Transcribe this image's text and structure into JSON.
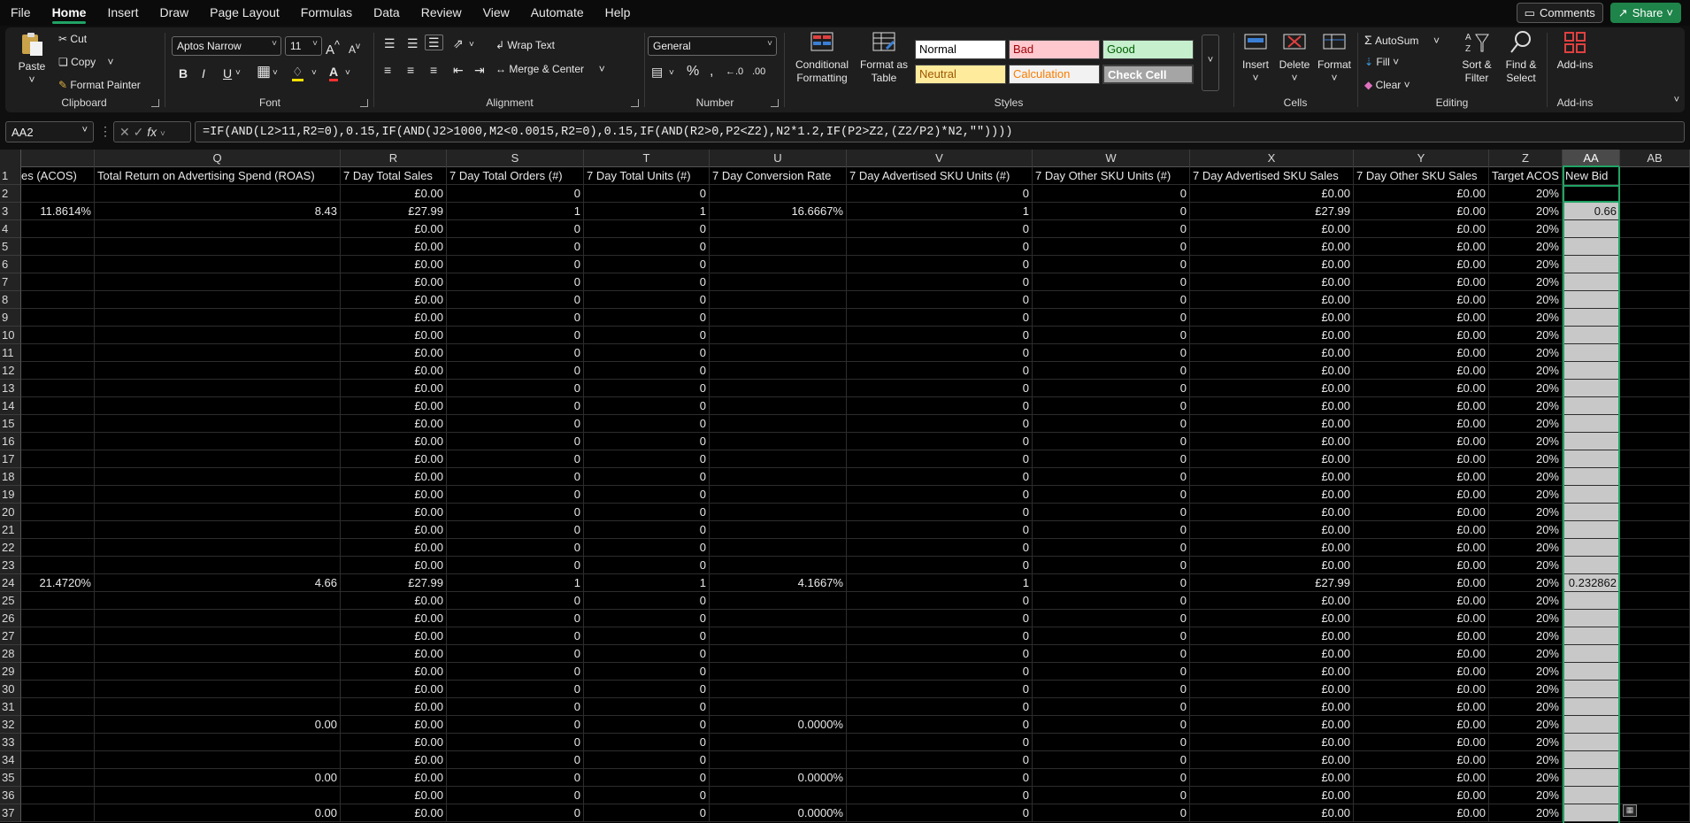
{
  "menu": [
    "File",
    "Home",
    "Insert",
    "Draw",
    "Page Layout",
    "Formulas",
    "Data",
    "Review",
    "View",
    "Automate",
    "Help"
  ],
  "topbar": {
    "comments": "Comments",
    "share": "Share"
  },
  "ribbon": {
    "clipboard": {
      "label": "Clipboard",
      "paste": "Paste",
      "cut": "Cut",
      "copy": "Copy",
      "format_painter": "Format Painter"
    },
    "font": {
      "label": "Font",
      "name": "Aptos Narrow",
      "size": "11",
      "grow": "A",
      "shrink": "A",
      "bold": "B",
      "italic": "I",
      "underline": "U"
    },
    "alignment": {
      "label": "Alignment",
      "wrap": "Wrap Text",
      "merge": "Merge & Center"
    },
    "number": {
      "label": "Number",
      "format": "General"
    },
    "styles": {
      "label": "Styles",
      "cond": "Conditional Formatting",
      "table": "Format as Table",
      "cells": [
        {
          "t": "Normal",
          "bg": "#ffffff",
          "fg": "#000000"
        },
        {
          "t": "Bad",
          "bg": "#ffc7ce",
          "fg": "#9c0006"
        },
        {
          "t": "Good",
          "bg": "#c6efce",
          "fg": "#006100"
        },
        {
          "t": "Neutral",
          "bg": "#ffeb9c",
          "fg": "#9c5700"
        },
        {
          "t": "Calculation",
          "bg": "#f2f2f2",
          "fg": "#fa7d00"
        },
        {
          "t": "Check Cell",
          "bg": "#a5a5a5",
          "fg": "#ffffff"
        }
      ]
    },
    "cells": {
      "label": "Cells",
      "insert": "Insert",
      "delete": "Delete",
      "format": "Format"
    },
    "editing": {
      "label": "Editing",
      "autosum": "AutoSum",
      "fill": "Fill",
      "clear": "Clear",
      "sort": "Sort & Filter",
      "find": "Find & Select"
    },
    "addins": {
      "label": "Add-ins",
      "btn": "Add-ins"
    }
  },
  "formula_bar": {
    "namebox": "AA2",
    "fx": "fx",
    "formula": "=IF(AND(L2>11,R2=0),0.15,IF(AND(J2>1000,M2<0.0015,R2=0),0.15,IF(AND(R2>0,P2<Z2),N2*1.2,IF(P2>Z2,(Z2/P2)*N2,\"\"))))"
  },
  "columns": [
    {
      "letter": "",
      "header": "es (ACOS)"
    },
    {
      "letter": "Q",
      "header": "Total Return on Advertising Spend (ROAS)"
    },
    {
      "letter": "R",
      "header": "7 Day Total Sales"
    },
    {
      "letter": "S",
      "header": "7 Day Total Orders (#)"
    },
    {
      "letter": "T",
      "header": "7 Day Total Units (#)"
    },
    {
      "letter": "U",
      "header": "7 Day Conversion Rate"
    },
    {
      "letter": "V",
      "header": "7 Day Advertised SKU Units (#)"
    },
    {
      "letter": "W",
      "header": "7 Day Other SKU Units (#)"
    },
    {
      "letter": "X",
      "header": "7 Day Advertised SKU Sales"
    },
    {
      "letter": "Y",
      "header": "7 Day Other SKU Sales"
    },
    {
      "letter": "Z",
      "header": "Target ACOS"
    },
    {
      "letter": "AA",
      "header": "New Bid"
    },
    {
      "letter": "AB",
      "header": ""
    }
  ],
  "rows": [
    {
      "n": "2",
      "p": "",
      "q": "",
      "r": "£0.00",
      "s": "0",
      "t": "0",
      "u": "",
      "v": "0",
      "w": "0",
      "x": "£0.00",
      "y": "£0.00",
      "z": "20%",
      "aa": ""
    },
    {
      "n": "3",
      "p": "11.8614%",
      "q": "8.43",
      "r": "£27.99",
      "s": "1",
      "t": "1",
      "u": "16.6667%",
      "v": "1",
      "w": "0",
      "x": "£27.99",
      "y": "£0.00",
      "z": "20%",
      "aa": "0.66"
    },
    {
      "n": "4",
      "p": "",
      "q": "",
      "r": "£0.00",
      "s": "0",
      "t": "0",
      "u": "",
      "v": "0",
      "w": "0",
      "x": "£0.00",
      "y": "£0.00",
      "z": "20%",
      "aa": ""
    },
    {
      "n": "5",
      "p": "",
      "q": "",
      "r": "£0.00",
      "s": "0",
      "t": "0",
      "u": "",
      "v": "0",
      "w": "0",
      "x": "£0.00",
      "y": "£0.00",
      "z": "20%",
      "aa": ""
    },
    {
      "n": "6",
      "p": "",
      "q": "",
      "r": "£0.00",
      "s": "0",
      "t": "0",
      "u": "",
      "v": "0",
      "w": "0",
      "x": "£0.00",
      "y": "£0.00",
      "z": "20%",
      "aa": ""
    },
    {
      "n": "7",
      "p": "",
      "q": "",
      "r": "£0.00",
      "s": "0",
      "t": "0",
      "u": "",
      "v": "0",
      "w": "0",
      "x": "£0.00",
      "y": "£0.00",
      "z": "20%",
      "aa": ""
    },
    {
      "n": "8",
      "p": "",
      "q": "",
      "r": "£0.00",
      "s": "0",
      "t": "0",
      "u": "",
      "v": "0",
      "w": "0",
      "x": "£0.00",
      "y": "£0.00",
      "z": "20%",
      "aa": ""
    },
    {
      "n": "9",
      "p": "",
      "q": "",
      "r": "£0.00",
      "s": "0",
      "t": "0",
      "u": "",
      "v": "0",
      "w": "0",
      "x": "£0.00",
      "y": "£0.00",
      "z": "20%",
      "aa": ""
    },
    {
      "n": "10",
      "p": "",
      "q": "",
      "r": "£0.00",
      "s": "0",
      "t": "0",
      "u": "",
      "v": "0",
      "w": "0",
      "x": "£0.00",
      "y": "£0.00",
      "z": "20%",
      "aa": ""
    },
    {
      "n": "11",
      "p": "",
      "q": "",
      "r": "£0.00",
      "s": "0",
      "t": "0",
      "u": "",
      "v": "0",
      "w": "0",
      "x": "£0.00",
      "y": "£0.00",
      "z": "20%",
      "aa": ""
    },
    {
      "n": "12",
      "p": "",
      "q": "",
      "r": "£0.00",
      "s": "0",
      "t": "0",
      "u": "",
      "v": "0",
      "w": "0",
      "x": "£0.00",
      "y": "£0.00",
      "z": "20%",
      "aa": ""
    },
    {
      "n": "13",
      "p": "",
      "q": "",
      "r": "£0.00",
      "s": "0",
      "t": "0",
      "u": "",
      "v": "0",
      "w": "0",
      "x": "£0.00",
      "y": "£0.00",
      "z": "20%",
      "aa": ""
    },
    {
      "n": "14",
      "p": "",
      "q": "",
      "r": "£0.00",
      "s": "0",
      "t": "0",
      "u": "",
      "v": "0",
      "w": "0",
      "x": "£0.00",
      "y": "£0.00",
      "z": "20%",
      "aa": ""
    },
    {
      "n": "15",
      "p": "",
      "q": "",
      "r": "£0.00",
      "s": "0",
      "t": "0",
      "u": "",
      "v": "0",
      "w": "0",
      "x": "£0.00",
      "y": "£0.00",
      "z": "20%",
      "aa": ""
    },
    {
      "n": "16",
      "p": "",
      "q": "",
      "r": "£0.00",
      "s": "0",
      "t": "0",
      "u": "",
      "v": "0",
      "w": "0",
      "x": "£0.00",
      "y": "£0.00",
      "z": "20%",
      "aa": ""
    },
    {
      "n": "17",
      "p": "",
      "q": "",
      "r": "£0.00",
      "s": "0",
      "t": "0",
      "u": "",
      "v": "0",
      "w": "0",
      "x": "£0.00",
      "y": "£0.00",
      "z": "20%",
      "aa": ""
    },
    {
      "n": "18",
      "p": "",
      "q": "",
      "r": "£0.00",
      "s": "0",
      "t": "0",
      "u": "",
      "v": "0",
      "w": "0",
      "x": "£0.00",
      "y": "£0.00",
      "z": "20%",
      "aa": ""
    },
    {
      "n": "19",
      "p": "",
      "q": "",
      "r": "£0.00",
      "s": "0",
      "t": "0",
      "u": "",
      "v": "0",
      "w": "0",
      "x": "£0.00",
      "y": "£0.00",
      "z": "20%",
      "aa": ""
    },
    {
      "n": "20",
      "p": "",
      "q": "",
      "r": "£0.00",
      "s": "0",
      "t": "0",
      "u": "",
      "v": "0",
      "w": "0",
      "x": "£0.00",
      "y": "£0.00",
      "z": "20%",
      "aa": ""
    },
    {
      "n": "21",
      "p": "",
      "q": "",
      "r": "£0.00",
      "s": "0",
      "t": "0",
      "u": "",
      "v": "0",
      "w": "0",
      "x": "£0.00",
      "y": "£0.00",
      "z": "20%",
      "aa": ""
    },
    {
      "n": "22",
      "p": "",
      "q": "",
      "r": "£0.00",
      "s": "0",
      "t": "0",
      "u": "",
      "v": "0",
      "w": "0",
      "x": "£0.00",
      "y": "£0.00",
      "z": "20%",
      "aa": ""
    },
    {
      "n": "23",
      "p": "",
      "q": "",
      "r": "£0.00",
      "s": "0",
      "t": "0",
      "u": "",
      "v": "0",
      "w": "0",
      "x": "£0.00",
      "y": "£0.00",
      "z": "20%",
      "aa": ""
    },
    {
      "n": "24",
      "p": "21.4720%",
      "q": "4.66",
      "r": "£27.99",
      "s": "1",
      "t": "1",
      "u": "4.1667%",
      "v": "1",
      "w": "0",
      "x": "£27.99",
      "y": "£0.00",
      "z": "20%",
      "aa": "0.232862"
    },
    {
      "n": "25",
      "p": "",
      "q": "",
      "r": "£0.00",
      "s": "0",
      "t": "0",
      "u": "",
      "v": "0",
      "w": "0",
      "x": "£0.00",
      "y": "£0.00",
      "z": "20%",
      "aa": ""
    },
    {
      "n": "26",
      "p": "",
      "q": "",
      "r": "£0.00",
      "s": "0",
      "t": "0",
      "u": "",
      "v": "0",
      "w": "0",
      "x": "£0.00",
      "y": "£0.00",
      "z": "20%",
      "aa": ""
    },
    {
      "n": "27",
      "p": "",
      "q": "",
      "r": "£0.00",
      "s": "0",
      "t": "0",
      "u": "",
      "v": "0",
      "w": "0",
      "x": "£0.00",
      "y": "£0.00",
      "z": "20%",
      "aa": ""
    },
    {
      "n": "28",
      "p": "",
      "q": "",
      "r": "£0.00",
      "s": "0",
      "t": "0",
      "u": "",
      "v": "0",
      "w": "0",
      "x": "£0.00",
      "y": "£0.00",
      "z": "20%",
      "aa": ""
    },
    {
      "n": "29",
      "p": "",
      "q": "",
      "r": "£0.00",
      "s": "0",
      "t": "0",
      "u": "",
      "v": "0",
      "w": "0",
      "x": "£0.00",
      "y": "£0.00",
      "z": "20%",
      "aa": ""
    },
    {
      "n": "30",
      "p": "",
      "q": "",
      "r": "£0.00",
      "s": "0",
      "t": "0",
      "u": "",
      "v": "0",
      "w": "0",
      "x": "£0.00",
      "y": "£0.00",
      "z": "20%",
      "aa": ""
    },
    {
      "n": "31",
      "p": "",
      "q": "",
      "r": "£0.00",
      "s": "0",
      "t": "0",
      "u": "",
      "v": "0",
      "w": "0",
      "x": "£0.00",
      "y": "£0.00",
      "z": "20%",
      "aa": ""
    },
    {
      "n": "32",
      "p": "",
      "q": "0.00",
      "r": "£0.00",
      "s": "0",
      "t": "0",
      "u": "0.0000%",
      "v": "0",
      "w": "0",
      "x": "£0.00",
      "y": "£0.00",
      "z": "20%",
      "aa": ""
    },
    {
      "n": "33",
      "p": "",
      "q": "",
      "r": "£0.00",
      "s": "0",
      "t": "0",
      "u": "",
      "v": "0",
      "w": "0",
      "x": "£0.00",
      "y": "£0.00",
      "z": "20%",
      "aa": ""
    },
    {
      "n": "34",
      "p": "",
      "q": "",
      "r": "£0.00",
      "s": "0",
      "t": "0",
      "u": "",
      "v": "0",
      "w": "0",
      "x": "£0.00",
      "y": "£0.00",
      "z": "20%",
      "aa": ""
    },
    {
      "n": "35",
      "p": "",
      "q": "0.00",
      "r": "£0.00",
      "s": "0",
      "t": "0",
      "u": "0.0000%",
      "v": "0",
      "w": "0",
      "x": "£0.00",
      "y": "£0.00",
      "z": "20%",
      "aa": ""
    },
    {
      "n": "36",
      "p": "",
      "q": "",
      "r": "£0.00",
      "s": "0",
      "t": "0",
      "u": "",
      "v": "0",
      "w": "0",
      "x": "£0.00",
      "y": "£0.00",
      "z": "20%",
      "aa": ""
    },
    {
      "n": "37",
      "p": "",
      "q": "0.00",
      "r": "£0.00",
      "s": "0",
      "t": "0",
      "u": "0.0000%",
      "v": "0",
      "w": "0",
      "x": "£0.00",
      "y": "£0.00",
      "z": "20%",
      "aa": ""
    }
  ]
}
